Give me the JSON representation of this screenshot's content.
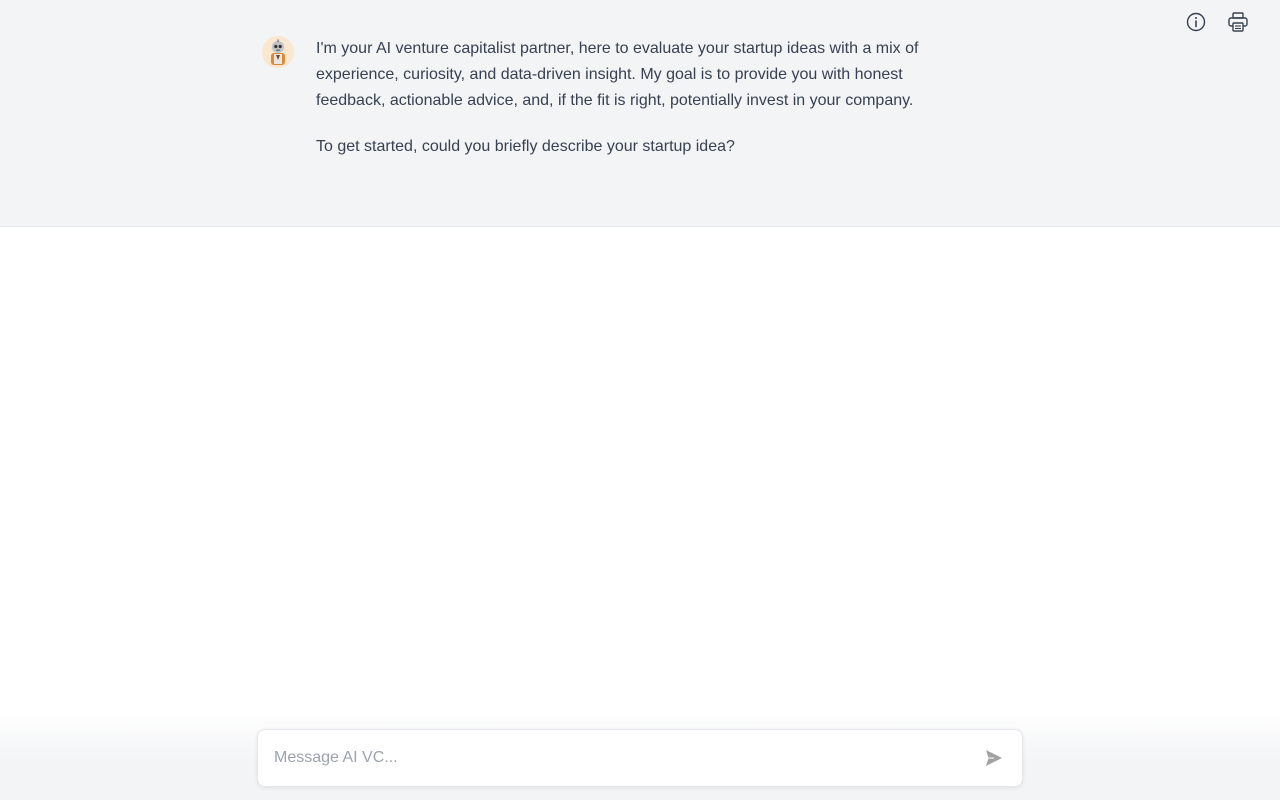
{
  "header": {
    "icons": [
      {
        "name": "info-icon"
      },
      {
        "name": "print-icon"
      }
    ]
  },
  "conversation": {
    "messages": [
      {
        "role": "assistant",
        "avatar": "vc-avatar",
        "paragraphs": [
          "I'm your AI venture capitalist partner, here to evaluate your startup ideas with a mix of experience, curiosity, and data-driven insight. My goal is to provide you with honest feedback, actionable advice, and, if the fit is right, potentially invest in your company.",
          "To get started, could you briefly describe your startup idea?"
        ]
      }
    ]
  },
  "composer": {
    "placeholder": "Message AI VC...",
    "value": "",
    "send_icon": "send-icon"
  },
  "colors": {
    "message_band": "#f3f4f6",
    "text": "#374151",
    "placeholder": "#9ca3af",
    "send_icon": "#a3a3a3"
  }
}
